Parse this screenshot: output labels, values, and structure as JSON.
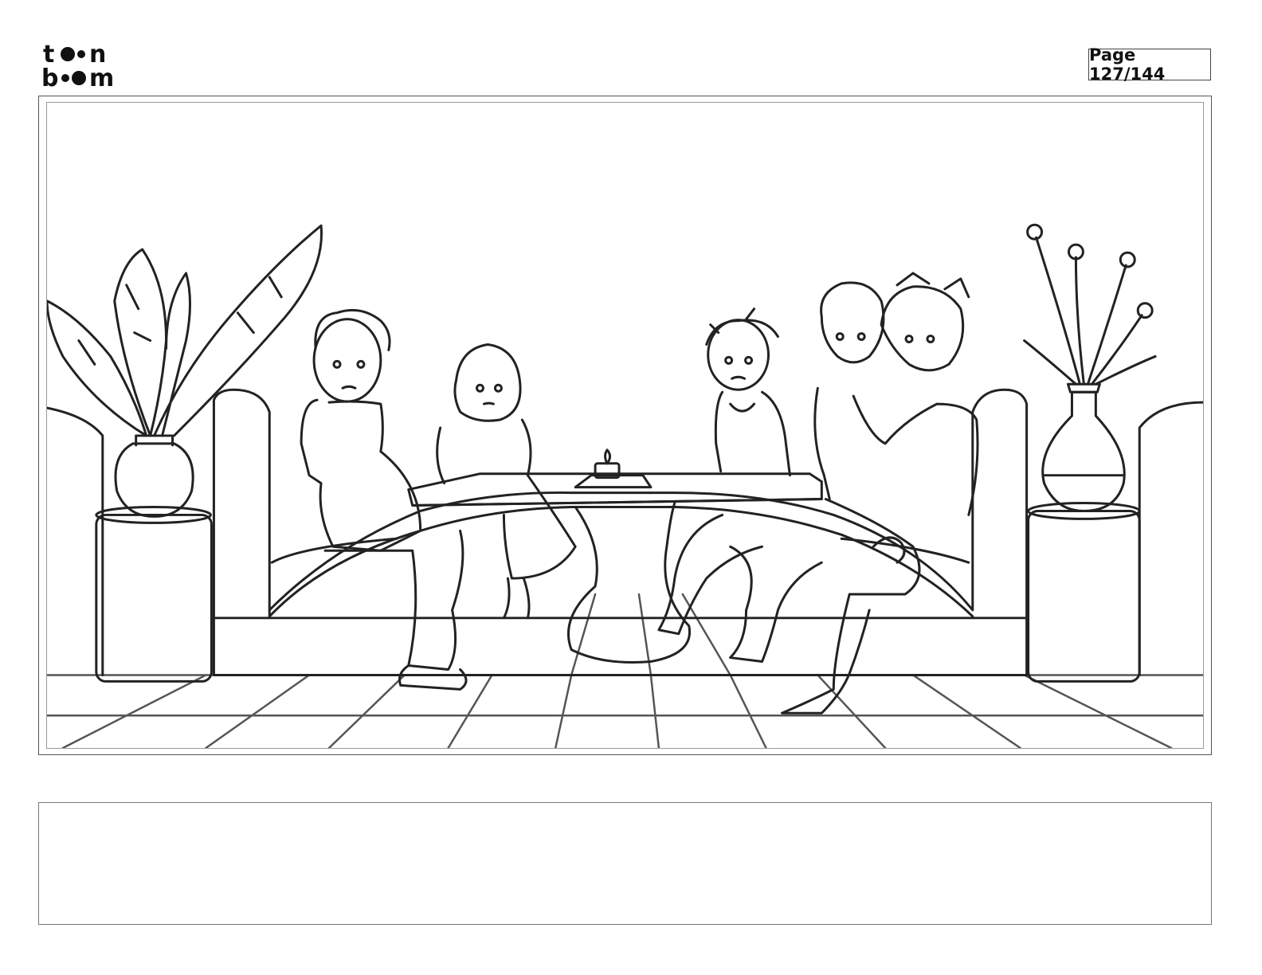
{
  "header": {
    "logo_line1": "toon",
    "logo_line2": "boom",
    "page_label": "Page 127/144"
  },
  "panel": {
    "drawing_icon": "storyboard-sketch"
  },
  "notes": {
    "text": ""
  }
}
